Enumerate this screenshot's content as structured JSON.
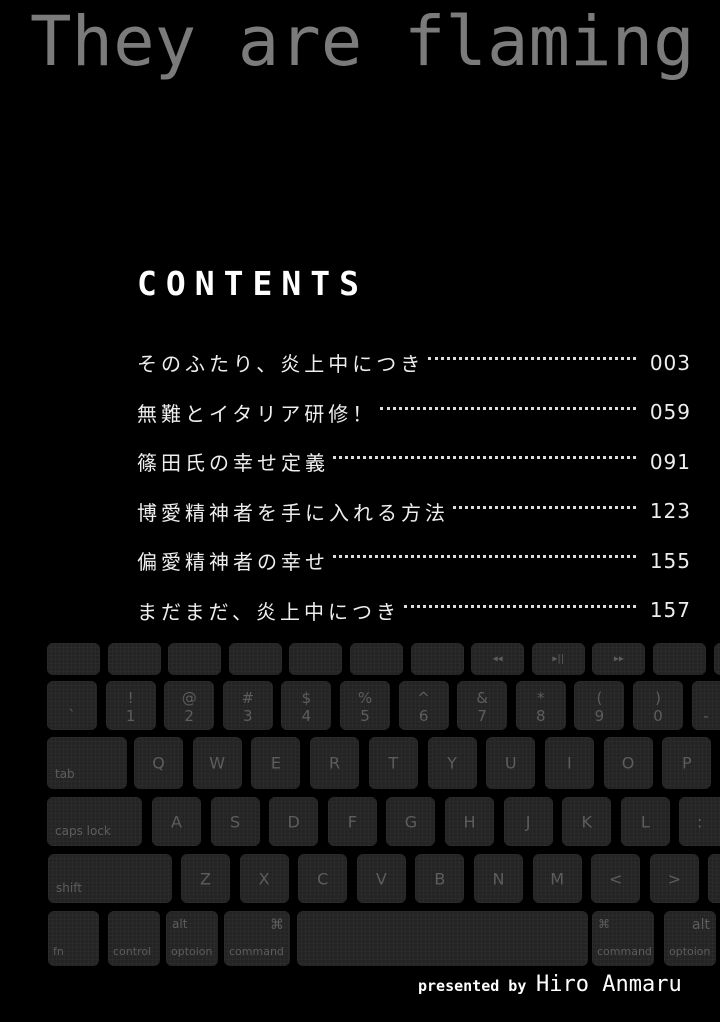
{
  "title": "They are flaming",
  "contents_heading": "CONTENTS",
  "toc": [
    {
      "title": "そのふたり、炎上中につき",
      "page": "003"
    },
    {
      "title": "無難とイタリア研修！",
      "page": "059"
    },
    {
      "title": "篠田氏の幸せ定義",
      "page": "091"
    },
    {
      "title": "博愛精神者を手に入れる方法",
      "page": "123"
    },
    {
      "title": "偏愛精神者の幸せ",
      "page": "155"
    },
    {
      "title": "まだまだ、炎上中につき",
      "page": "157"
    }
  ],
  "keyboard": {
    "row1": [
      "",
      "",
      "",
      "",
      "",
      "",
      "",
      "◂◂",
      "▸||",
      "▸▸",
      "",
      ""
    ],
    "row2": [
      [
        "",
        "`"
      ],
      [
        "!",
        "1"
      ],
      [
        "@",
        "2"
      ],
      [
        "#",
        "3"
      ],
      [
        "$",
        "4"
      ],
      [
        "%",
        "5"
      ],
      [
        "^",
        "6"
      ],
      [
        "&",
        "7"
      ],
      [
        "*",
        "8"
      ],
      [
        "(",
        "9"
      ],
      [
        ")",
        "0"
      ],
      [
        "",
        "-"
      ]
    ],
    "row3": [
      "tab",
      "Q",
      "W",
      "E",
      "R",
      "T",
      "Y",
      "U",
      "I",
      "O",
      "P"
    ],
    "row4": [
      "caps lock",
      "A",
      "S",
      "D",
      "F",
      "G",
      "H",
      "J",
      "K",
      "L",
      ":"
    ],
    "row5": [
      "shift",
      "Z",
      "X",
      "C",
      "V",
      "B",
      "N",
      "M",
      "<",
      ">",
      ""
    ],
    "row6": [
      {
        "bottom": "fn"
      },
      {
        "bottom": "control"
      },
      {
        "top": "alt",
        "bottom": "optoion"
      },
      {
        "top": "⌘",
        "bottom": "command"
      },
      {
        "bottom": ""
      },
      {
        "top": "⌘",
        "bottom": "command"
      },
      {
        "top": "alt",
        "bottom": "optoion"
      }
    ]
  },
  "credit": {
    "prefix": "presented by",
    "author": "Hiro Anmaru"
  },
  "colors": {
    "background": "#000000",
    "title": "#7b7b7b",
    "key": "#242424",
    "key_label": "#5d5d5d",
    "text": "#ffffff"
  }
}
